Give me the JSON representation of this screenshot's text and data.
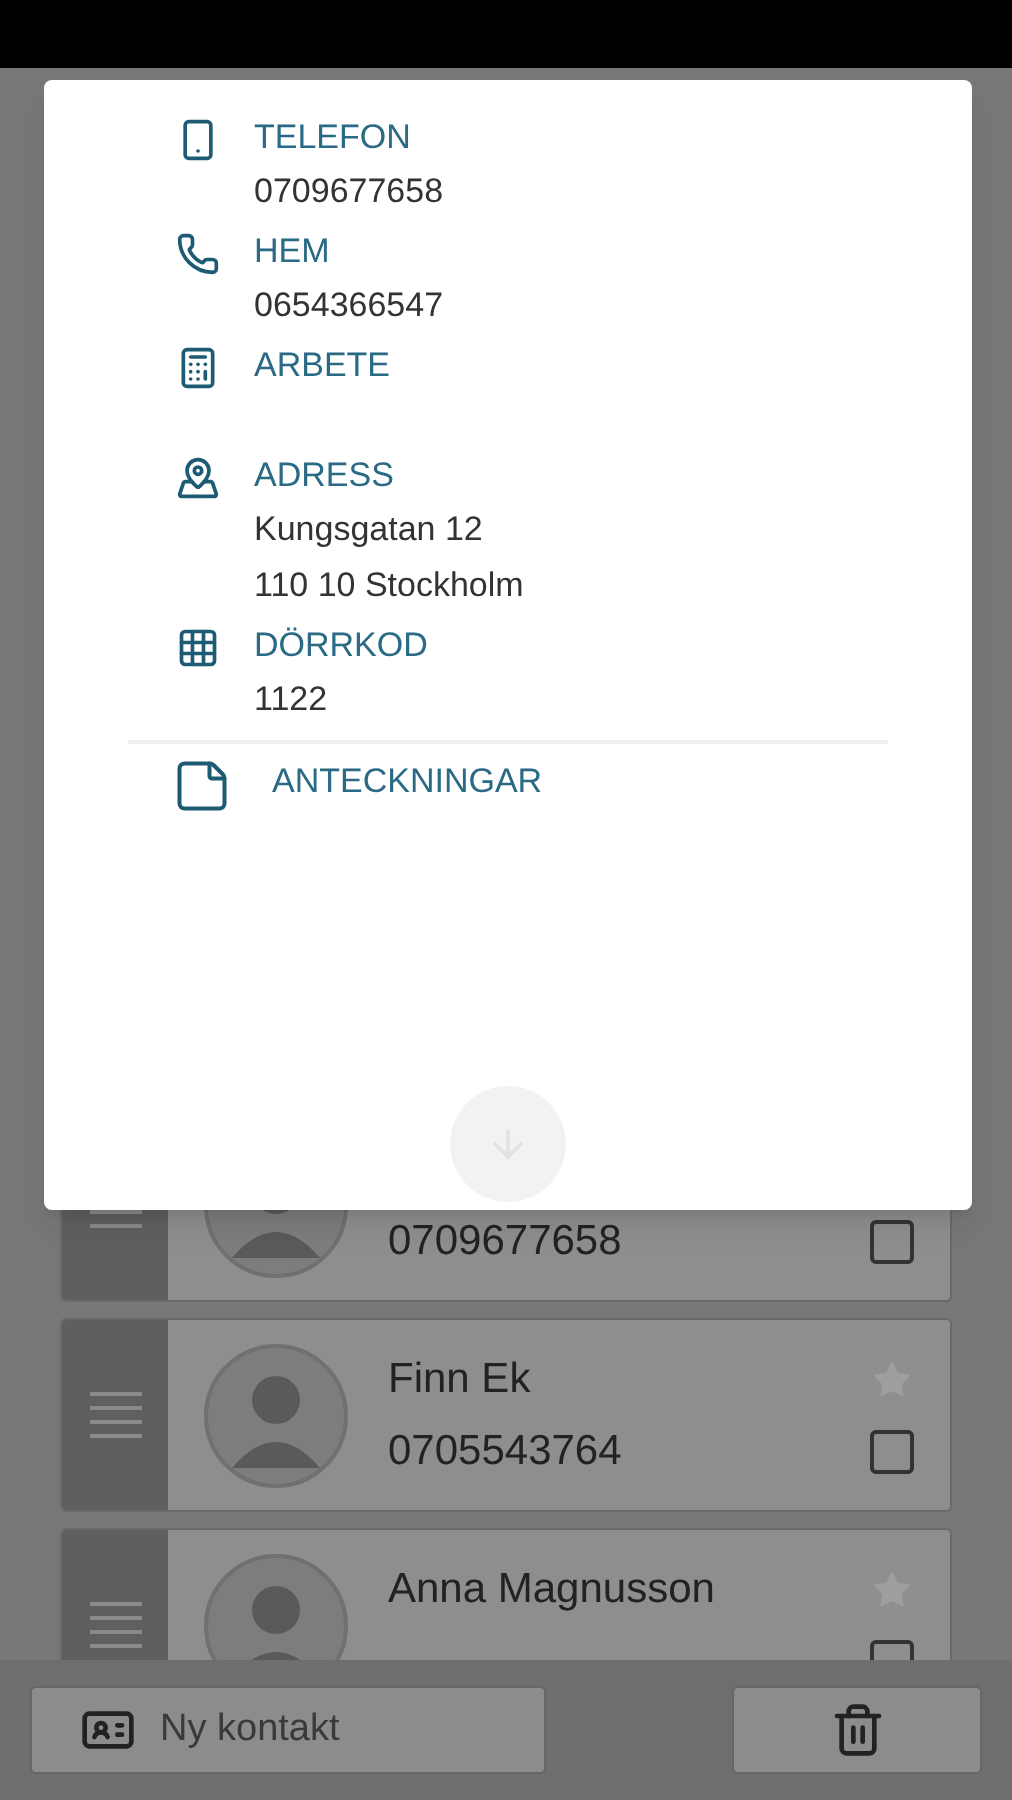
{
  "dialog": {
    "fields": [
      {
        "kind": "mobile",
        "label": "TELEFON",
        "lines": [
          "0709677658"
        ]
      },
      {
        "kind": "home",
        "label": "HEM",
        "lines": [
          "0654366547"
        ]
      },
      {
        "kind": "work",
        "label": "ARBETE"
      },
      {
        "kind": "address",
        "label": "ADRESS",
        "lines": [
          "Kungsgatan 12",
          "110 10 Stockholm"
        ]
      },
      {
        "kind": "doorcode",
        "label": "DÖRRKOD",
        "lines": [
          "1122"
        ]
      }
    ],
    "notes": {
      "label": "ANTECKNINGAR"
    }
  },
  "contacts": [
    {
      "phone": "0709677658",
      "checked": false
    },
    {
      "name": "Finn Ek",
      "phone": "0705543764",
      "favorite": false,
      "checked": false
    },
    {
      "name": "Anna Magnusson",
      "favorite": false,
      "checked": false
    }
  ],
  "bottom_bar": {
    "new_contact": "Ny kontakt"
  }
}
